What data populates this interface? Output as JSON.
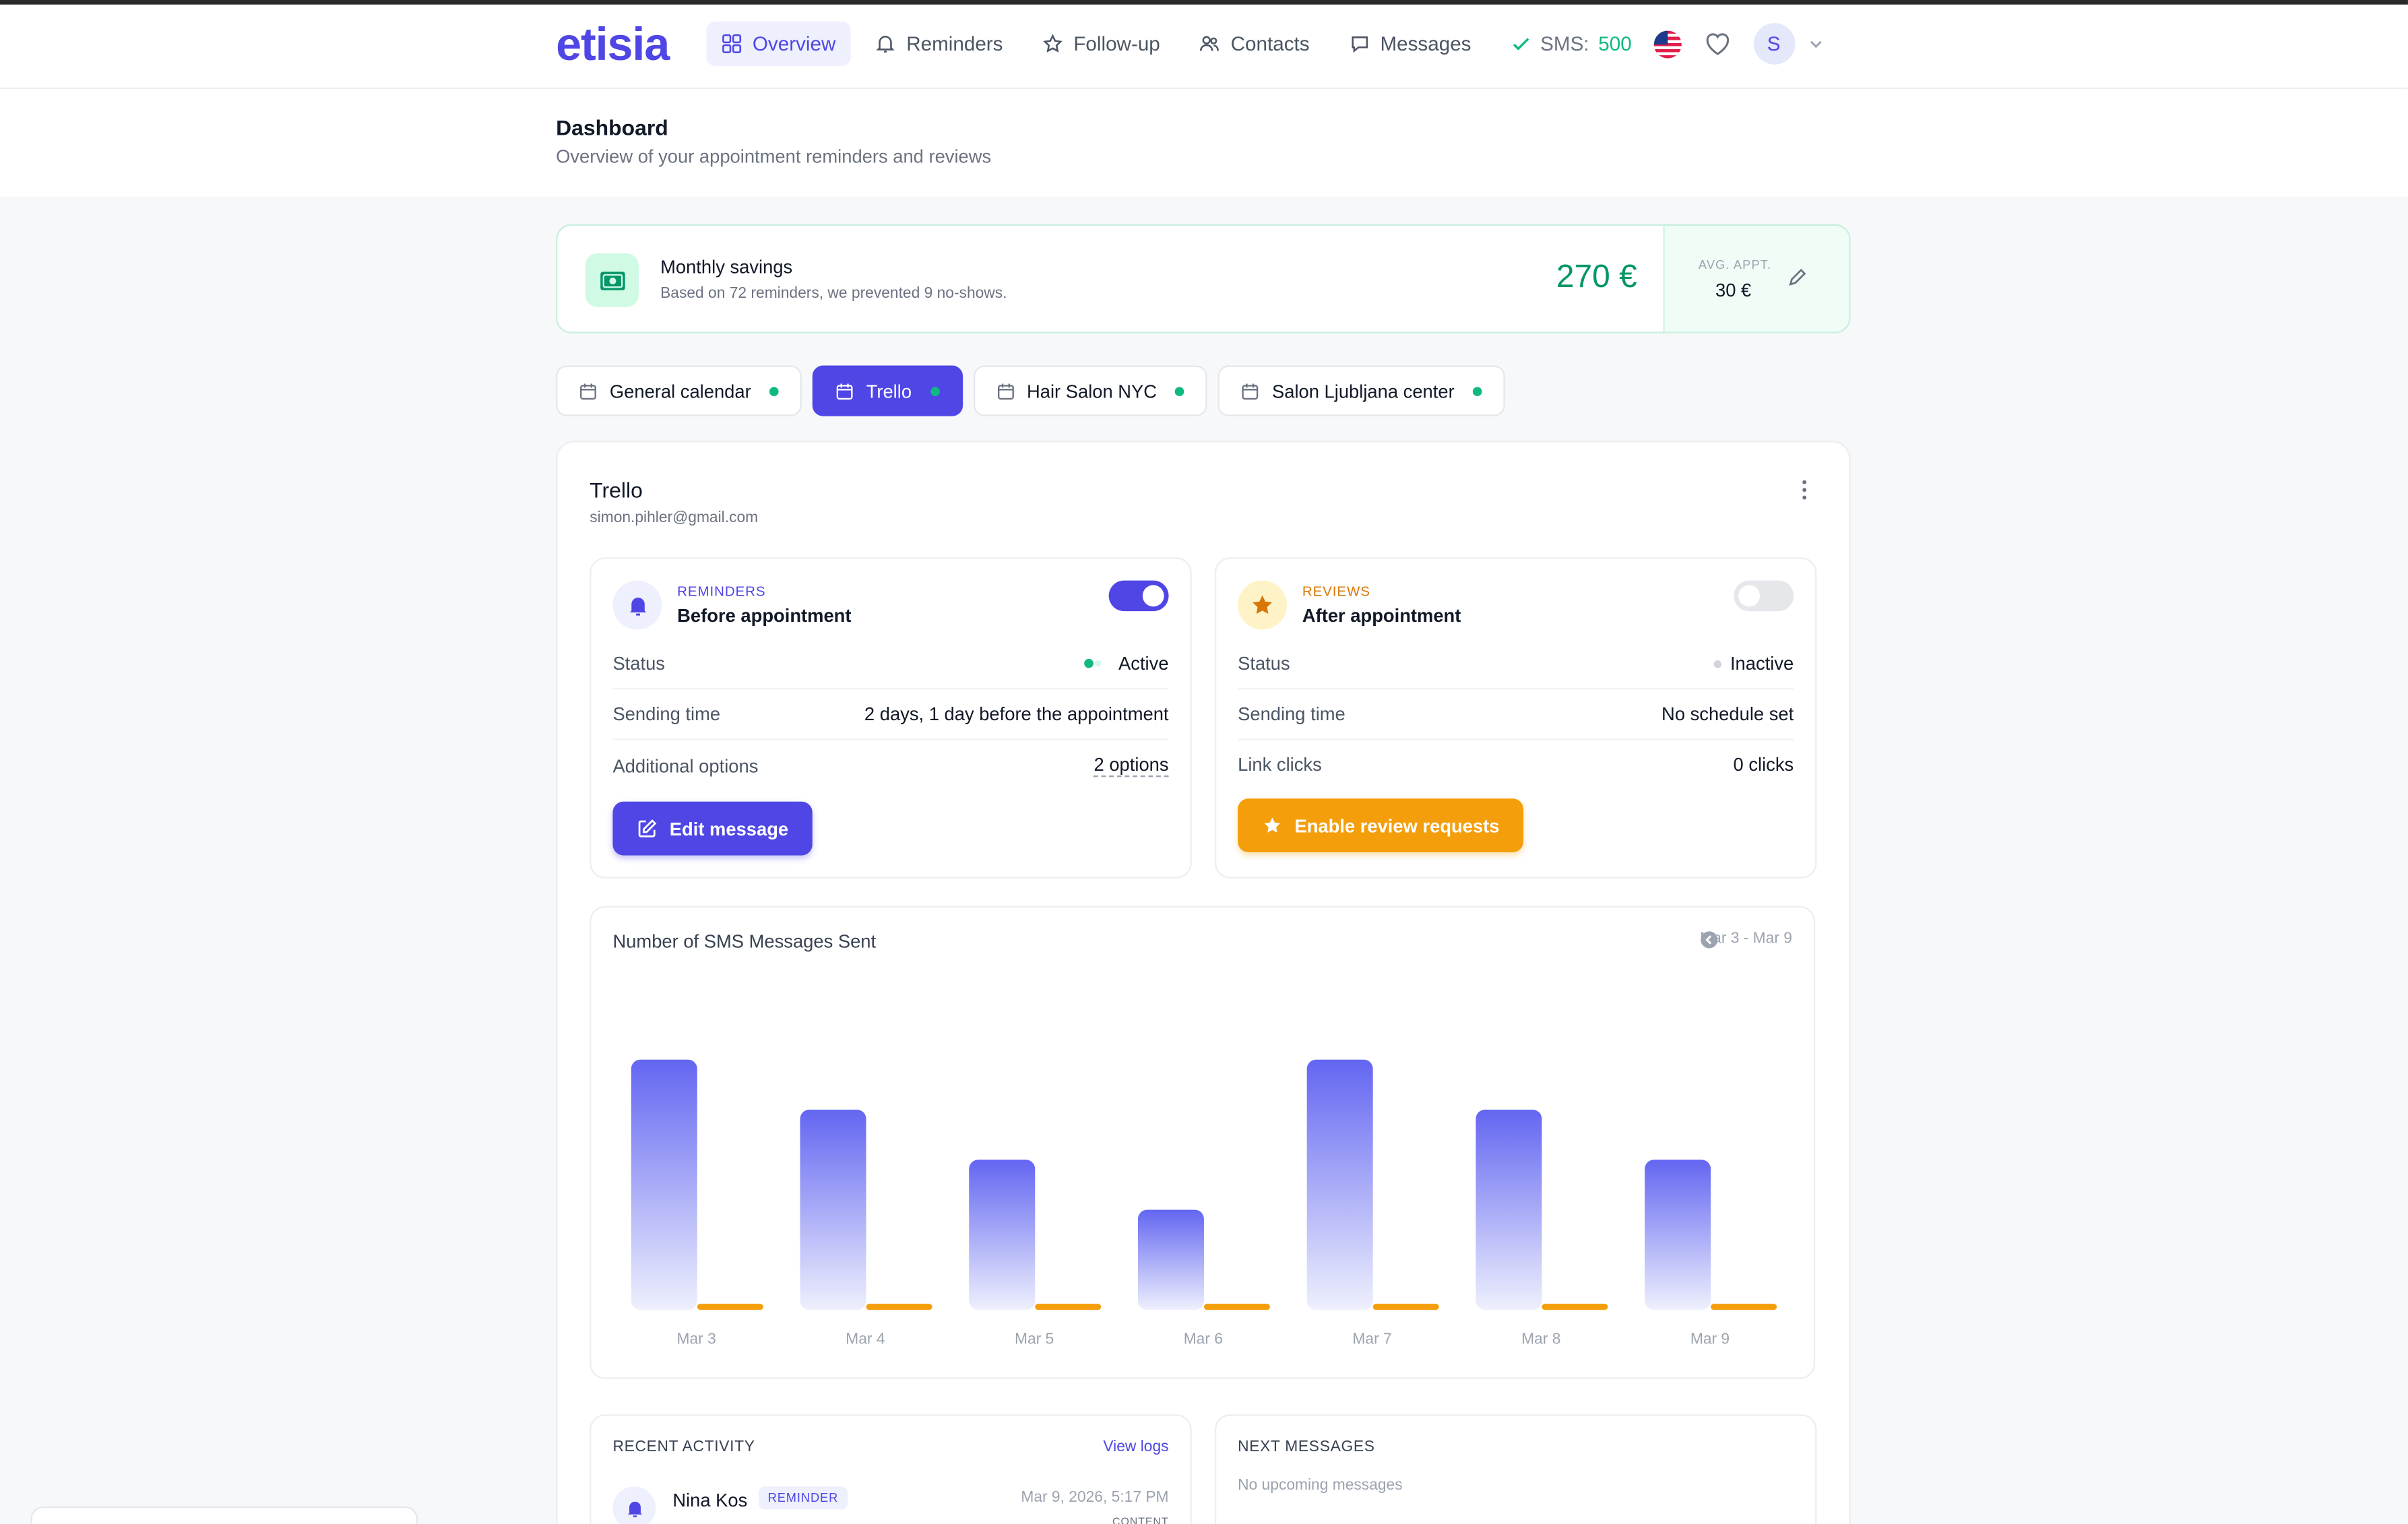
{
  "app": {
    "logo": "etisia"
  },
  "nav": {
    "items": [
      {
        "label": "Overview",
        "icon": "grid-icon",
        "active": true
      },
      {
        "label": "Reminders",
        "icon": "bell-icon"
      },
      {
        "label": "Follow-up",
        "icon": "star-icon"
      },
      {
        "label": "Contacts",
        "icon": "users-icon"
      },
      {
        "label": "Messages",
        "icon": "chat-icon"
      }
    ],
    "sms_label": "SMS:",
    "sms_count": "500",
    "avatar_initial": "S"
  },
  "header": {
    "title": "Dashboard",
    "subtitle": "Overview of your appointment reminders and reviews"
  },
  "savings": {
    "title": "Monthly savings",
    "subtitle": "Based on 72 reminders, we prevented 9 no-shows.",
    "amount": "270 €",
    "avg_label": "AVG. APPT.",
    "avg_value": "30 €"
  },
  "tabs": [
    {
      "label": "General calendar",
      "active": false
    },
    {
      "label": "Trello",
      "active": true
    },
    {
      "label": "Hair Salon NYC",
      "active": false
    },
    {
      "label": "Salon Ljubljana center",
      "active": false
    }
  ],
  "calendar": {
    "name": "Trello",
    "email": "simon.pihler@gmail.com"
  },
  "reminders": {
    "kind": "REMINDERS",
    "name": "Before appointment",
    "enabled": true,
    "rows": [
      {
        "label": "Status",
        "value": "Active"
      },
      {
        "label": "Sending time",
        "value": "2 days, 1 day before the appointment"
      },
      {
        "label": "Additional options",
        "value": "2 options"
      }
    ],
    "button": "Edit message",
    "colors": {
      "accent": "#4f46e5",
      "status": "#10b981"
    }
  },
  "reviews": {
    "kind": "REVIEWS",
    "name": "After appointment",
    "enabled": false,
    "rows": [
      {
        "label": "Status",
        "value": "Inactive"
      },
      {
        "label": "Sending time",
        "value": "No schedule set"
      },
      {
        "label": "Link clicks",
        "value": "0 clicks"
      }
    ],
    "button": "Enable review requests",
    "colors": {
      "accent": "#f59e0b",
      "status": "#d1d5db"
    }
  },
  "chart_data": {
    "type": "bar",
    "title": "Number of SMS Messages Sent",
    "range": "Mar 3 - Mar 9",
    "categories": [
      "Mar 3",
      "Mar 4",
      "Mar 5",
      "Mar 6",
      "Mar 7",
      "Mar 8",
      "Mar 9"
    ],
    "series": [
      {
        "values": [
          5,
          4,
          3,
          2,
          5,
          4,
          3
        ],
        "color": "#6366f1"
      },
      {
        "values": [
          0,
          0,
          0,
          0,
          0,
          0,
          0
        ],
        "color": "#f59e0b"
      }
    ],
    "ylim": [
      0,
      5
    ],
    "grid": false,
    "legend": false
  },
  "activity": {
    "title": "RECENT ACTIVITY",
    "link": "View logs",
    "item": {
      "name": "Nina Kos",
      "badge": "REMINDER",
      "time": "Mar 9, 2026, 5:17 PM",
      "tag": "CONTENT"
    }
  },
  "next": {
    "title": "NEXT MESSAGES",
    "empty": "No upcoming messages"
  }
}
